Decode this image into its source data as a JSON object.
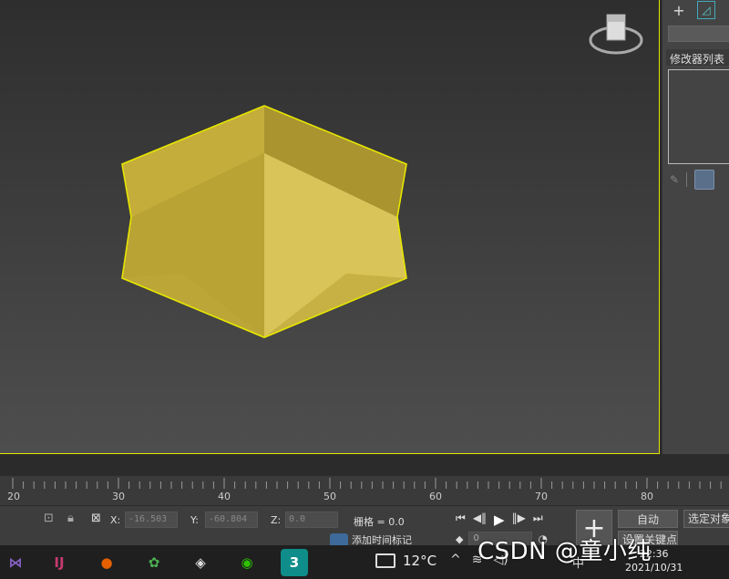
{
  "command_panel": {
    "create_tab_icon": "plus-icon",
    "modify_tab_icon": "modify-icon",
    "modifier_list_label": "修改器列表",
    "pin_icon": "pin-icon"
  },
  "timeline": {
    "tick_labels": [
      "20",
      "30",
      "40",
      "50",
      "60",
      "70",
      "80"
    ]
  },
  "status": {
    "x_label": "X:",
    "x_value": "-16.503",
    "y_label": "Y:",
    "y_value": "-60.804",
    "z_label": "Z:",
    "z_value": "0.0",
    "grid_label": "栅格 = 0.0",
    "add_time_tag": "添加时间标记",
    "frame_value": "0",
    "auto_key": "自动",
    "set_key": "设置关键点",
    "selected": "选定对象"
  },
  "taskbar": {
    "apps": [
      {
        "name": "visual-studio",
        "glyph": "⋈",
        "color": "#8661c5"
      },
      {
        "name": "jetbrains",
        "glyph": "IJ",
        "color": "#c43a6e"
      },
      {
        "name": "firefox",
        "glyph": "●",
        "color": "#e66000"
      },
      {
        "name": "sogou",
        "glyph": "✿",
        "color": "#4caf50"
      },
      {
        "name": "unity",
        "glyph": "◈",
        "color": "#dddddd"
      },
      {
        "name": "wechat",
        "glyph": "◉",
        "color": "#2dc100"
      },
      {
        "name": "3dsmax",
        "glyph": "3",
        "color": "#0f8d8a"
      }
    ],
    "temperature": "12°C",
    "ime": "中",
    "time": "22:36",
    "date": "2021/10/31"
  },
  "watermark": "CSDN @童小纯",
  "colors": {
    "selection": "#e6e600",
    "model_face": "#c9b23e",
    "viewport_top": "#2e2e2e",
    "viewport_bottom": "#4e4e4e"
  }
}
